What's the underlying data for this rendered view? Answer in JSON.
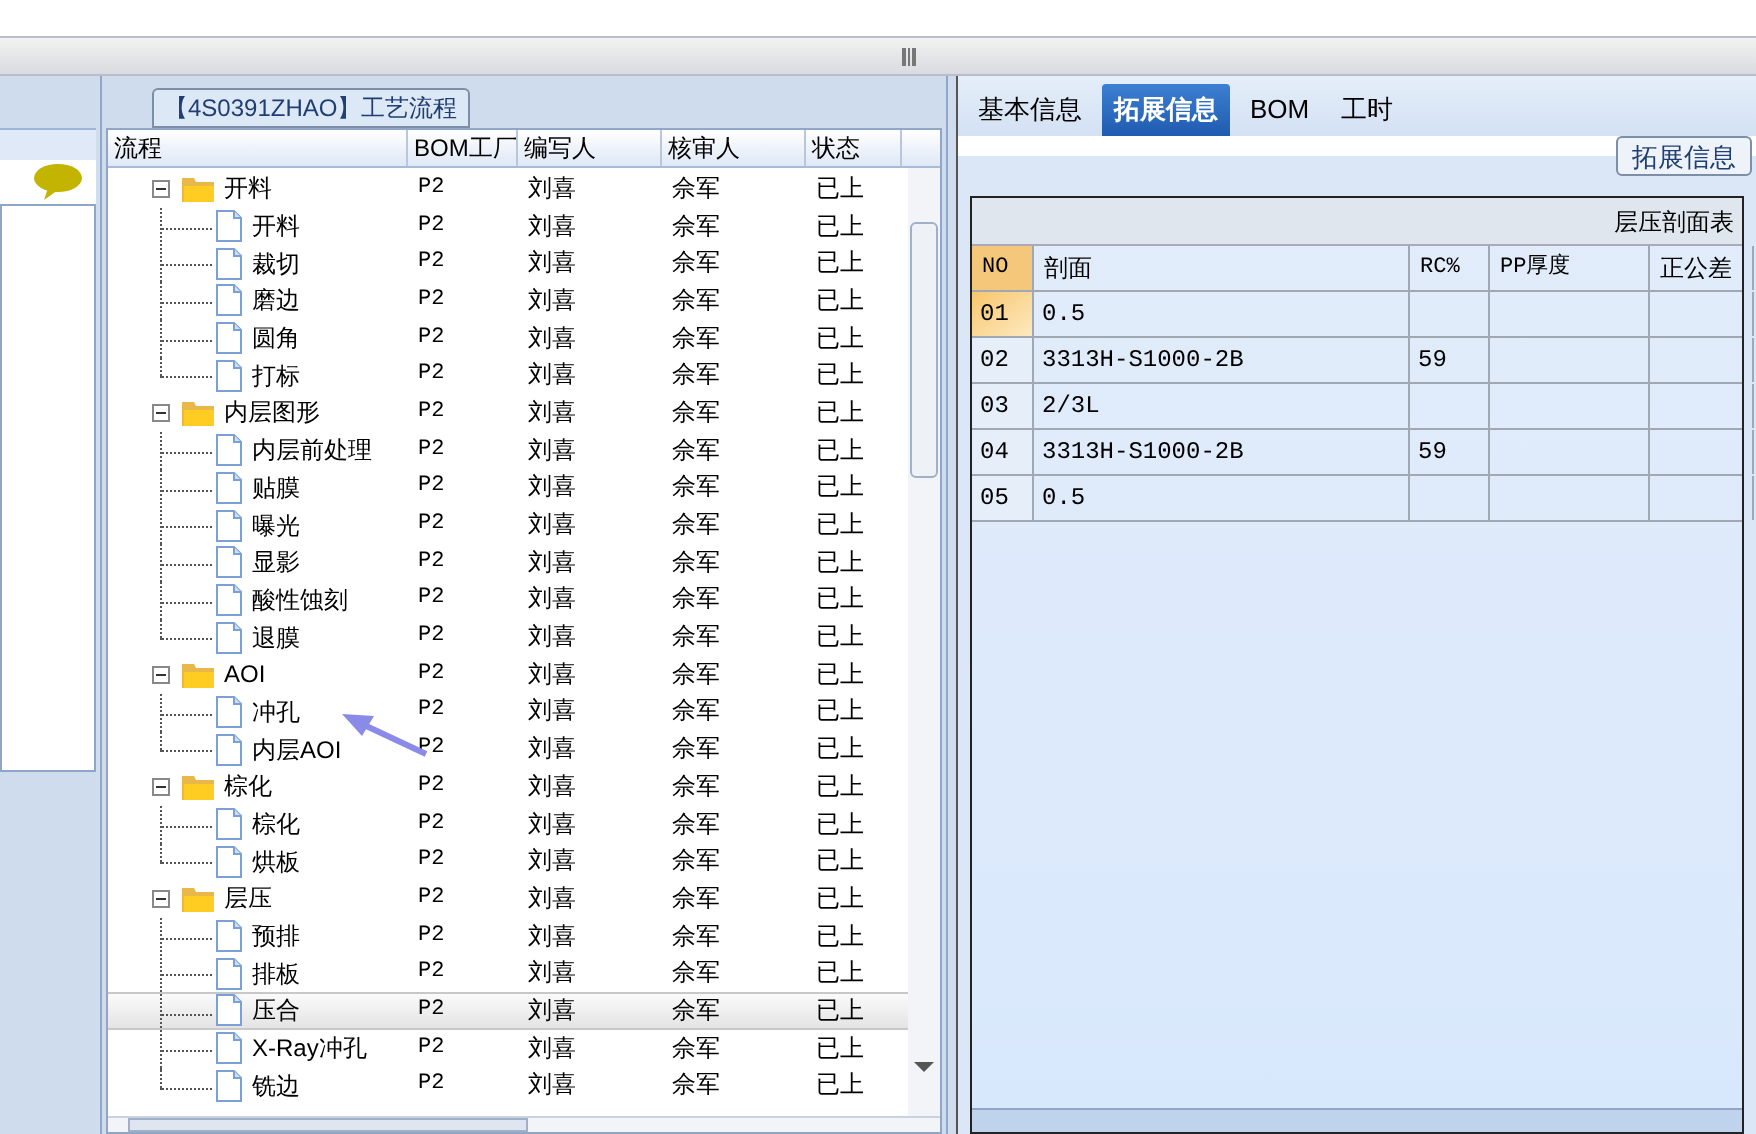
{
  "process_panel": {
    "title": "【4S0391ZHAO】工艺流程",
    "columns": [
      "流程",
      "BOM工厂",
      "编写人",
      "核审人",
      "状态"
    ],
    "rows": [
      {
        "name": "开料",
        "bom": "P2",
        "writer": "刘喜",
        "reviewer": "佘军",
        "status": "已上",
        "expanded": true,
        "selected": false,
        "children": [
          {
            "name": "开料",
            "bom": "P2",
            "writer": "刘喜",
            "reviewer": "佘军",
            "status": "已上",
            "selected": false
          },
          {
            "name": "裁切",
            "bom": "P2",
            "writer": "刘喜",
            "reviewer": "佘军",
            "status": "已上",
            "selected": false
          },
          {
            "name": "磨边",
            "bom": "P2",
            "writer": "刘喜",
            "reviewer": "佘军",
            "status": "已上",
            "selected": false
          },
          {
            "name": "圆角",
            "bom": "P2",
            "writer": "刘喜",
            "reviewer": "佘军",
            "status": "已上",
            "selected": false
          },
          {
            "name": "打标",
            "bom": "P2",
            "writer": "刘喜",
            "reviewer": "佘军",
            "status": "已上",
            "selected": false
          }
        ]
      },
      {
        "name": "内层图形",
        "bom": "P2",
        "writer": "刘喜",
        "reviewer": "佘军",
        "status": "已上",
        "expanded": true,
        "selected": false,
        "children": [
          {
            "name": "内层前处理",
            "bom": "P2",
            "writer": "刘喜",
            "reviewer": "佘军",
            "status": "已上",
            "selected": false
          },
          {
            "name": "贴膜",
            "bom": "P2",
            "writer": "刘喜",
            "reviewer": "佘军",
            "status": "已上",
            "selected": false
          },
          {
            "name": "曝光",
            "bom": "P2",
            "writer": "刘喜",
            "reviewer": "佘军",
            "status": "已上",
            "selected": false
          },
          {
            "name": "显影",
            "bom": "P2",
            "writer": "刘喜",
            "reviewer": "佘军",
            "status": "已上",
            "selected": false
          },
          {
            "name": "酸性蚀刻",
            "bom": "P2",
            "writer": "刘喜",
            "reviewer": "佘军",
            "status": "已上",
            "selected": false
          },
          {
            "name": "退膜",
            "bom": "P2",
            "writer": "刘喜",
            "reviewer": "佘军",
            "status": "已上",
            "selected": false
          }
        ]
      },
      {
        "name": "AOI",
        "bom": "P2",
        "writer": "刘喜",
        "reviewer": "佘军",
        "status": "已上",
        "expanded": true,
        "selected": false,
        "children": [
          {
            "name": "冲孔",
            "bom": "P2",
            "writer": "刘喜",
            "reviewer": "佘军",
            "status": "已上",
            "selected": false
          },
          {
            "name": "内层AOI",
            "bom": "P2",
            "writer": "刘喜",
            "reviewer": "佘军",
            "status": "已上",
            "selected": false
          }
        ]
      },
      {
        "name": "棕化",
        "bom": "P2",
        "writer": "刘喜",
        "reviewer": "佘军",
        "status": "已上",
        "expanded": true,
        "selected": false,
        "children": [
          {
            "name": "棕化",
            "bom": "P2",
            "writer": "刘喜",
            "reviewer": "佘军",
            "status": "已上",
            "selected": false
          },
          {
            "name": "烘板",
            "bom": "P2",
            "writer": "刘喜",
            "reviewer": "佘军",
            "status": "已上",
            "selected": false
          }
        ]
      },
      {
        "name": "层压",
        "bom": "P2",
        "writer": "刘喜",
        "reviewer": "佘军",
        "status": "已上",
        "expanded": true,
        "selected": false,
        "children": [
          {
            "name": "预排",
            "bom": "P2",
            "writer": "刘喜",
            "reviewer": "佘军",
            "status": "已上",
            "selected": false
          },
          {
            "name": "排板",
            "bom": "P2",
            "writer": "刘喜",
            "reviewer": "佘军",
            "status": "已上",
            "selected": false
          },
          {
            "name": "压合",
            "bom": "P2",
            "writer": "刘喜",
            "reviewer": "佘军",
            "status": "已上",
            "selected": true
          },
          {
            "name": "X-Ray冲孔",
            "bom": "P2",
            "writer": "刘喜",
            "reviewer": "佘军",
            "status": "已上",
            "selected": false
          },
          {
            "name": "铣边",
            "bom": "P2",
            "writer": "刘喜",
            "reviewer": "佘军",
            "status": "已上",
            "selected": false
          }
        ]
      }
    ]
  },
  "detail_panel": {
    "tabs": [
      {
        "label": "基本信息",
        "selected": false
      },
      {
        "label": "拓展信息",
        "selected": true
      },
      {
        "label": "BOM",
        "selected": false
      },
      {
        "label": "工时",
        "selected": false
      }
    ],
    "group_title": "拓展信息",
    "table": {
      "title": "层压剖面表",
      "columns": [
        "NO",
        "剖面",
        "RC%",
        "PP厚度",
        "正公差"
      ],
      "rows": [
        {
          "no": "01",
          "profile": "0.5",
          "rc": "",
          "selected": true
        },
        {
          "no": "02",
          "profile": "3313H-S1000-2B",
          "rc": "59",
          "selected": false
        },
        {
          "no": "03",
          "profile": "2/3L",
          "rc": "",
          "selected": false
        },
        {
          "no": "04",
          "profile": "3313H-S1000-2B",
          "rc": "59",
          "selected": false
        },
        {
          "no": "05",
          "profile": "0.5",
          "rc": "",
          "selected": false
        }
      ]
    }
  }
}
